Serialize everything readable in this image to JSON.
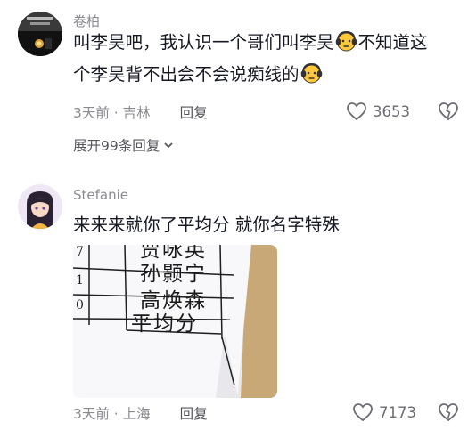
{
  "comments": [
    {
      "username": "卷柏",
      "text_line1_a": "叫李昊吧，我认识一个哥们叫李昊",
      "text_line1_b": "不知道这",
      "text_line2_a": "个李昊背不出会不会说痴线的",
      "location_time": "3天前 · 吉林",
      "reply_label": "回复",
      "likes": "3653",
      "expand_label": "展开99条回复",
      "emoji": "earmuff-face-emoji"
    },
    {
      "username": "Stefanie",
      "text": "来来来就你了平均分 就你名字特殊",
      "location_time": "3天前 · 上海",
      "reply_label": "回复",
      "likes": "7173",
      "photo_rows": [
        "贾咏英",
        "孙颢宁",
        "高焕森",
        "平均分"
      ],
      "photo_left_numbers": [
        "7",
        "1",
        "0"
      ]
    }
  ],
  "colors": {
    "primary_text": "#161823",
    "secondary_text": "#8a8b91",
    "background": "#ffffff"
  }
}
